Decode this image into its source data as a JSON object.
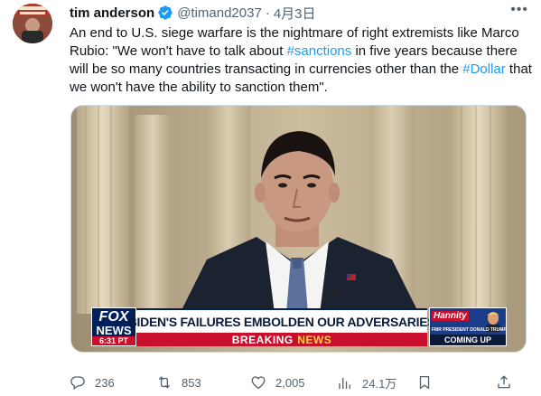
{
  "author": {
    "name": "tim anderson",
    "handle": "@timand2037",
    "separator": "·",
    "date": "4月3日"
  },
  "tweet": {
    "segments": [
      {
        "text": "An end to U.S. siege warfare is the nightmare of right extremists like Marco Rubio: \"We won't have to talk about ",
        "type": "text"
      },
      {
        "text": "#sanctions",
        "type": "hashtag"
      },
      {
        "text": " in five years because there will be so many countries transacting in currencies other than the ",
        "type": "text"
      },
      {
        "text": "#Dollar",
        "type": "hashtag"
      },
      {
        "text": " that we won't have the ability to sanction them\".",
        "type": "text"
      }
    ]
  },
  "media": {
    "lower_third": {
      "network_top": "FOX",
      "network_bottom": "NEWS",
      "time": "6:31 PT",
      "headline": "BIDEN'S FAILURES EMBOLDEN OUR ADVERSARIES",
      "breaking_1": "BREAKING",
      "breaking_2": "NEWS",
      "promo_show": "Hannity",
      "promo_guest": "FMR PRESIDENT DONALD TRUMP",
      "promo_cta": "COMING UP"
    }
  },
  "actions": {
    "replies": "236",
    "retweets": "853",
    "likes": "2,005",
    "views": "24.1万"
  },
  "colors": {
    "hashtag": "#1d9bf0",
    "verified": "#1d9bf0",
    "breaking_red": "#c8102e",
    "fox_blue": "#00205b"
  }
}
